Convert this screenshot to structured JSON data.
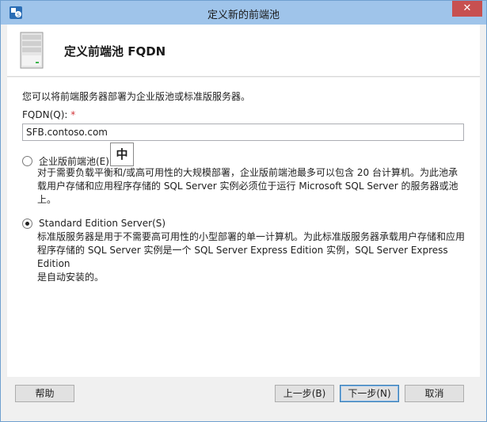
{
  "window": {
    "title": "定义新的前端池"
  },
  "header": {
    "title": "定义前端池 FQDN"
  },
  "content": {
    "intro": "您可以将前端服务器部署为企业版池或标准版服务器。",
    "fqdn_label": "FQDN(Q):",
    "fqdn_required_mark": "*",
    "fqdn_value": "SFB.contoso.com",
    "options": [
      {
        "label": "企业版前端池(E)",
        "checked": false,
        "description_lines": [
          "对于需要负载平衡和/或高可用性的大规模部署，企业版前端池最多可以包含 20 台计算机。为此池承",
          "载用户存储和应用程序存储的 SQL Server 实例必须位于运行 Microsoft SQL Server 的服务器或池",
          "上。"
        ]
      },
      {
        "label": "Standard Edition Server(S)",
        "checked": true,
        "description_lines": [
          "标准版服务器是用于不需要高可用性的小型部署的单一计算机。为此标准版服务器承载用户存储和应用",
          "程序存储的 SQL Server 实例是一个 SQL Server Express Edition 实例，SQL Server Express Edition",
          "是自动安装的。"
        ]
      }
    ],
    "ime_indicator": "中"
  },
  "footer": {
    "help": "帮助",
    "back": "上一步(B)",
    "next": "下一步(N)",
    "cancel": "取消"
  },
  "icons": {
    "app": "lync-setup-icon",
    "header": "server-icon",
    "close": "close-icon"
  },
  "colors": {
    "titlebar": "#9fc4ea",
    "close": "#c75050",
    "required": "#d13438"
  }
}
